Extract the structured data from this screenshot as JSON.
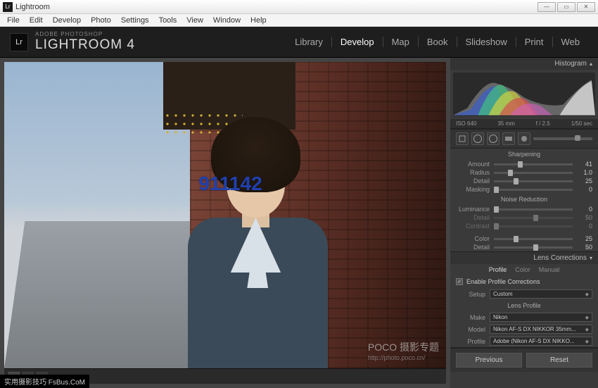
{
  "window": {
    "title": "Lightroom"
  },
  "menubar": [
    "File",
    "Edit",
    "Develop",
    "Photo",
    "Settings",
    "Tools",
    "View",
    "Window",
    "Help"
  ],
  "brand": {
    "sub": "ADOBE PHOTOSHOP",
    "main": "LIGHTROOM 4",
    "badge": "Lr"
  },
  "modules": [
    "Library",
    "Develop",
    "Map",
    "Book",
    "Slideshow",
    "Print",
    "Web"
  ],
  "active_module": "Develop",
  "overlay": "911142",
  "watermark": {
    "main": "POCO 摄影专题",
    "url": "http://photo.poco.cn/"
  },
  "histogram": {
    "title": "Histogram",
    "iso": "ISO 640",
    "focal": "35 mm",
    "aperture": "f / 2.5",
    "shutter": "1/50 sec"
  },
  "detail": {
    "sharpening": {
      "title": "Sharpening",
      "rows": [
        {
          "label": "Amount",
          "val": "41",
          "pos": 30
        },
        {
          "label": "Radius",
          "val": "1.0",
          "pos": 18
        },
        {
          "label": "Detail",
          "val": "25",
          "pos": 25
        },
        {
          "label": "Masking",
          "val": "0",
          "pos": 0
        }
      ]
    },
    "noise": {
      "title": "Noise Reduction",
      "rows": [
        {
          "label": "Luminance",
          "val": "0",
          "pos": 0,
          "dim": false
        },
        {
          "label": "Detail",
          "val": "50",
          "pos": 50,
          "dim": true
        },
        {
          "label": "Contrast",
          "val": "0",
          "pos": 0,
          "dim": true
        }
      ],
      "color_rows": [
        {
          "label": "Color",
          "val": "25",
          "pos": 25
        },
        {
          "label": "Detail",
          "val": "50",
          "pos": 50
        }
      ]
    }
  },
  "lens": {
    "title": "Lens Corrections",
    "tabs": [
      "Profile",
      "Color",
      "Manual"
    ],
    "active_tab": "Profile",
    "enable_label": "Enable Profile Corrections",
    "enabled": true,
    "setup_label": "Setup",
    "setup_value": "Custom",
    "profile_header": "Lens Profile",
    "make_label": "Make",
    "make_value": "Nikon",
    "model_label": "Model",
    "model_value": "Nikon AF-S DX NIKKOR 35mm...",
    "profile_label": "Profile",
    "profile_value": "Adobe (Nikon AF-S DX NIKKO..."
  },
  "buttons": {
    "previous": "Previous",
    "reset": "Reset"
  },
  "bottom_tag": "实用摄影技巧 FsBus.CoM"
}
